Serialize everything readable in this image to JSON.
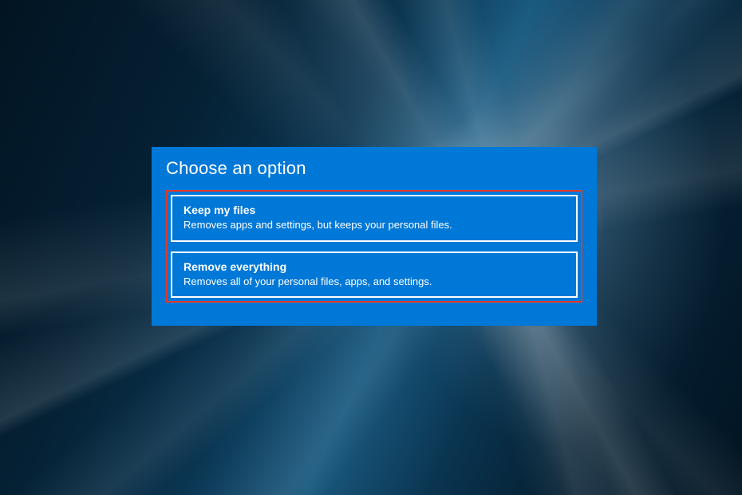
{
  "dialog": {
    "title": "Choose an option",
    "options": [
      {
        "title": "Keep my files",
        "description": "Removes apps and settings, but keeps your personal files."
      },
      {
        "title": "Remove everything",
        "description": "Removes all of your personal files, apps, and settings."
      }
    ]
  },
  "colors": {
    "dialog_bg": "#0078d7",
    "highlight_border": "#e03a2a",
    "text": "#ffffff"
  }
}
